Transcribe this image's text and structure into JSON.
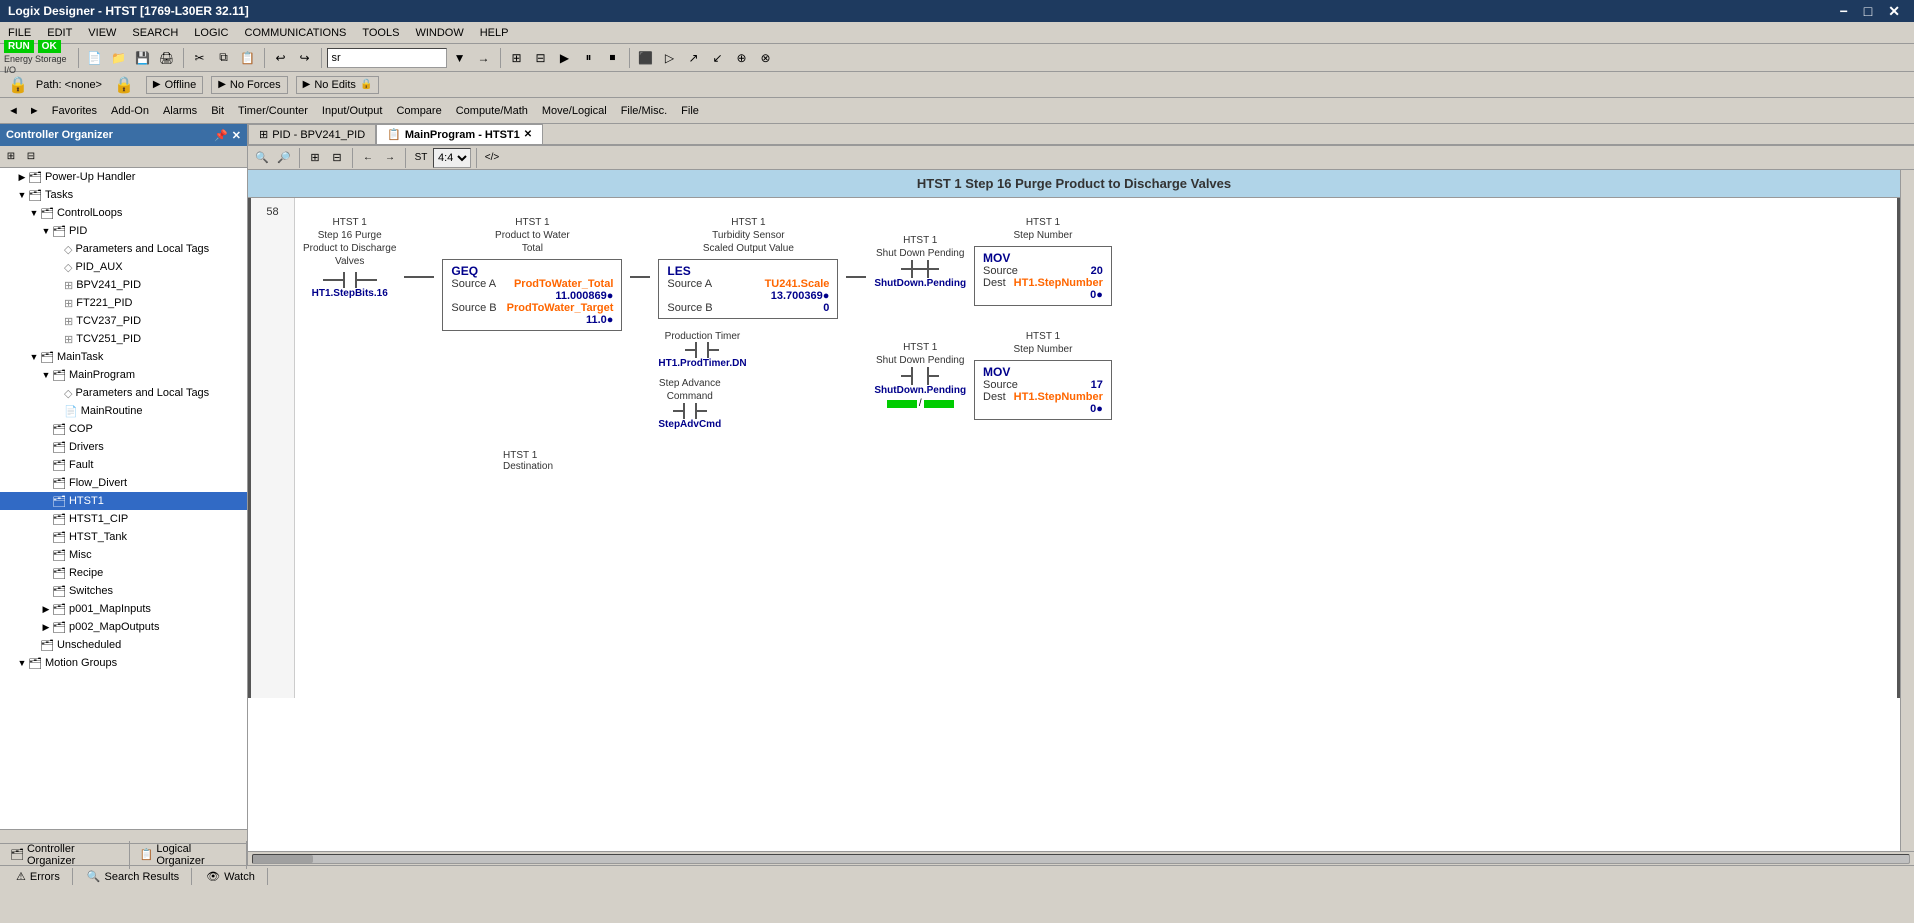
{
  "app": {
    "title": "Logix Designer - HTST [1769-L30ER 32.11]",
    "title_prefix": "Logix Designer",
    "title_project": "HTST [1769-L30ER 32.11]"
  },
  "titlebar_controls": [
    "−",
    "□",
    "✕"
  ],
  "menu": {
    "items": [
      "FILE",
      "EDIT",
      "VIEW",
      "SEARCH",
      "LOGIC",
      "COMMUNICATIONS",
      "TOOLS",
      "WINDOW",
      "HELP"
    ]
  },
  "status_indicators": {
    "run": "RUN",
    "ok": "OK",
    "energy": "Energy Storage",
    "io": "I/O"
  },
  "statusbar": {
    "path_label": "Path: <none>",
    "offline": "Offline",
    "no_forces": "No Forces",
    "no_edits": "No Edits"
  },
  "fav_bar": {
    "nav_left": "◄",
    "nav_right": "►",
    "items": [
      "Favorites",
      "Add-On",
      "Alarms",
      "Bit",
      "Timer/Counter",
      "Input/Output",
      "Compare",
      "Compute/Math",
      "Move/Logical",
      "File/Misc.",
      "File"
    ]
  },
  "ctrl_panel": {
    "title": "Controller Organizer",
    "tree": [
      {
        "id": "power-up",
        "label": "Power-Up Handler",
        "icon": "📁",
        "indent": 1,
        "arrow": "▶"
      },
      {
        "id": "tasks",
        "label": "Tasks",
        "icon": "📁",
        "indent": 1,
        "arrow": "▼"
      },
      {
        "id": "control-loops",
        "label": "ControlLoops",
        "icon": "📁",
        "indent": 2,
        "arrow": "▼"
      },
      {
        "id": "pid",
        "label": "PID",
        "icon": "📁",
        "indent": 3,
        "arrow": "▼"
      },
      {
        "id": "params-local-1",
        "label": "Parameters and Local Tags",
        "icon": "◇",
        "indent": 4,
        "arrow": ""
      },
      {
        "id": "pid-aux",
        "label": "PID_AUX",
        "icon": "◇",
        "indent": 4,
        "arrow": ""
      },
      {
        "id": "bpv241-pid",
        "label": "BPV241_PID",
        "icon": "⊞",
        "indent": 4,
        "arrow": ""
      },
      {
        "id": "ft221-pid",
        "label": "FT221_PID",
        "icon": "⊞",
        "indent": 4,
        "arrow": ""
      },
      {
        "id": "tcv237-pid",
        "label": "TCV237_PID",
        "icon": "⊞",
        "indent": 4,
        "arrow": ""
      },
      {
        "id": "tcv251-pid",
        "label": "TCV251_PID",
        "icon": "⊞",
        "indent": 4,
        "arrow": ""
      },
      {
        "id": "main-task",
        "label": "MainTask",
        "icon": "📁",
        "indent": 2,
        "arrow": "▼"
      },
      {
        "id": "main-program",
        "label": "MainProgram",
        "icon": "📁",
        "indent": 3,
        "arrow": "▼"
      },
      {
        "id": "params-local-2",
        "label": "Parameters and Local Tags",
        "icon": "◇",
        "indent": 4,
        "arrow": ""
      },
      {
        "id": "main-routine",
        "label": "MainRoutine",
        "icon": "📄",
        "indent": 4,
        "arrow": ""
      },
      {
        "id": "cop",
        "label": "COP",
        "icon": "📁",
        "indent": 3,
        "arrow": ""
      },
      {
        "id": "drivers",
        "label": "Drivers",
        "icon": "📁",
        "indent": 3,
        "arrow": ""
      },
      {
        "id": "fault",
        "label": "Fault",
        "icon": "📁",
        "indent": 3,
        "arrow": ""
      },
      {
        "id": "flow-divert",
        "label": "Flow_Divert",
        "icon": "📁",
        "indent": 3,
        "arrow": ""
      },
      {
        "id": "htst1",
        "label": "HTST1",
        "icon": "📁",
        "indent": 3,
        "arrow": "",
        "selected": true
      },
      {
        "id": "htst1-cip",
        "label": "HTST1_CIP",
        "icon": "📁",
        "indent": 3,
        "arrow": ""
      },
      {
        "id": "htst-tank",
        "label": "HTST_Tank",
        "icon": "📁",
        "indent": 3,
        "arrow": ""
      },
      {
        "id": "misc",
        "label": "Misc",
        "icon": "📁",
        "indent": 3,
        "arrow": ""
      },
      {
        "id": "recipe",
        "label": "Recipe",
        "icon": "📁",
        "indent": 3,
        "arrow": ""
      },
      {
        "id": "switches",
        "label": "Switches",
        "icon": "📁",
        "indent": 3,
        "arrow": ""
      },
      {
        "id": "p001-map-inputs",
        "label": "p001_MapInputs",
        "icon": "📁",
        "indent": 3,
        "arrow": "▶"
      },
      {
        "id": "p002-map-outputs",
        "label": "p002_MapOutputs",
        "icon": "📁",
        "indent": 3,
        "arrow": "▶"
      },
      {
        "id": "unscheduled",
        "label": "Unscheduled",
        "icon": "📁",
        "indent": 2,
        "arrow": ""
      },
      {
        "id": "motion-groups",
        "label": "Motion Groups",
        "icon": "📁",
        "indent": 1,
        "arrow": "▼"
      }
    ]
  },
  "tabs": [
    {
      "id": "pid-bpv",
      "label": "PID - BPV241_PID",
      "active": false,
      "closable": false
    },
    {
      "id": "main-program",
      "label": "MainProgram - HTST1",
      "active": true,
      "closable": true
    }
  ],
  "ctrl_bottom_tabs": [
    {
      "id": "ctrl-organizer",
      "label": "Controller Organizer",
      "icon": "🗂"
    },
    {
      "id": "logical-organizer",
      "label": "Logical Organizer",
      "icon": "📋"
    }
  ],
  "bottom_tabs": [
    {
      "id": "errors",
      "label": "Errors",
      "icon": "⚠"
    },
    {
      "id": "search-results",
      "label": "Search Results",
      "icon": "🔍"
    },
    {
      "id": "watch",
      "label": "Watch",
      "icon": "👁"
    }
  ],
  "ladder_zoom_toolbar": {
    "buttons": [
      "🔍+",
      "🔍-",
      "⊞",
      "⊟",
      "←",
      "→"
    ]
  },
  "diagram": {
    "header": "HTST 1 Step 16 Purge Product to Discharge Valves",
    "rung_number": "58",
    "rung_annotations": {
      "left_top1": "HTST 1",
      "left_top2": "Step 16 Purge",
      "left_top3": "Product to Discharge",
      "left_top4": "Valves",
      "left_value": "HT1.StepBits.16",
      "center_top1": "HTST 1",
      "center_top2": "Product to Water",
      "center_top3": "Total",
      "center_value_a": "ProdToWater_Total",
      "center_value_a_num": "11.000869●",
      "center_value_b": "ProdToWater_Target",
      "center_value_b_num": "11.0●",
      "geq_title": "GEQ",
      "geq_sourcea": "Source A",
      "geq_sourceb": "Source B",
      "les_title": "LES",
      "les_top1": "HTST 1",
      "les_top2": "Turbidity Sensor",
      "les_top3": "Scaled Output Value",
      "les_sourcea": "Source A",
      "les_sourcea_val": "TU241.Scale",
      "les_sourcea_num": "13.700369●",
      "les_sourceb": "Source B",
      "les_sourceb_val": "0",
      "prod_timer_label": "Production Timer",
      "prod_timer_val": "HT1.ProdTimer.DN",
      "step_advance_label": "Step Advance",
      "step_advance_label2": "Command",
      "step_advance_val": "StepAdvCmd",
      "right1_top1": "HTST 1",
      "right1_top2": "Shut Down Pending",
      "right1_val": "ShutDown.Pending",
      "right2_top1": "HTST 1",
      "right2_top2": "Step Number",
      "mov1_title": "MOV",
      "mov1_source_label": "Source",
      "mov1_source_val": "20",
      "mov1_dest_label": "Dest",
      "mov1_dest_val": "HT1.StepNumber",
      "mov1_dest_num": "0●",
      "shutdown_pending2": "ShutDown.Pending",
      "led_label": "/",
      "right3_top1": "HTST 1",
      "right3_top2": "Step Number",
      "mov2_title": "MOV",
      "mov2_source_label": "Source",
      "mov2_source_val": "17",
      "mov2_dest_label": "Dest",
      "mov2_dest_val": "HT1.StepNumber",
      "mov2_dest_num": "0●",
      "dest_label": "HTST 1",
      "dest_label2": "Destination"
    }
  }
}
